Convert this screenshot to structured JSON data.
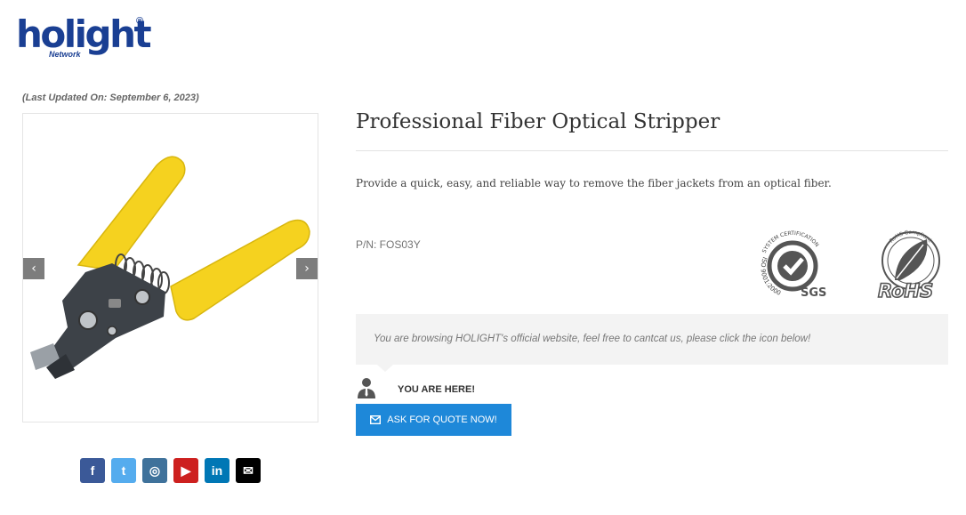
{
  "brand": {
    "name": "holight",
    "sub": "Network",
    "reg": "®"
  },
  "updated": "(Last Updated On: September 6, 2023)",
  "gallery": {
    "prev": "‹",
    "next": "›"
  },
  "social": [
    {
      "name": "facebook-icon",
      "glyph": "f",
      "color": "#3b5998"
    },
    {
      "name": "twitter-icon",
      "glyph": "t",
      "color": "#55acee"
    },
    {
      "name": "instagram-icon",
      "glyph": "◎",
      "color": "#3f729b"
    },
    {
      "name": "youtube-icon",
      "glyph": "▶",
      "color": "#cd201f"
    },
    {
      "name": "linkedin-icon",
      "glyph": "in",
      "color": "#0077b5"
    },
    {
      "name": "email-icon",
      "glyph": "✉",
      "color": "#000000"
    }
  ],
  "product": {
    "title": "Professional Fiber Optical Stripper",
    "description": "Provide a quick, easy, and reliable way to remove the fiber jackets from an optical fiber.",
    "pn": "P/N: FOS03Y"
  },
  "certs": {
    "sgs_top": "SYSTEM CERTIFICATION",
    "sgs_left": "ISO 9001:2000",
    "sgs_mark": "SGS",
    "rohs": "RoHS",
    "rohs_ring": "RoHS Compliant"
  },
  "notice": "You are browsing HOLIGHT's official website, feel free to cantcat us, please click the icon below!",
  "here": "YOU ARE HERE!",
  "quote": "ASK FOR QUOTE NOW!",
  "colors": {
    "brand": "#1a3f93",
    "accent": "#1e88d9",
    "yellow": "#f5d21f"
  }
}
